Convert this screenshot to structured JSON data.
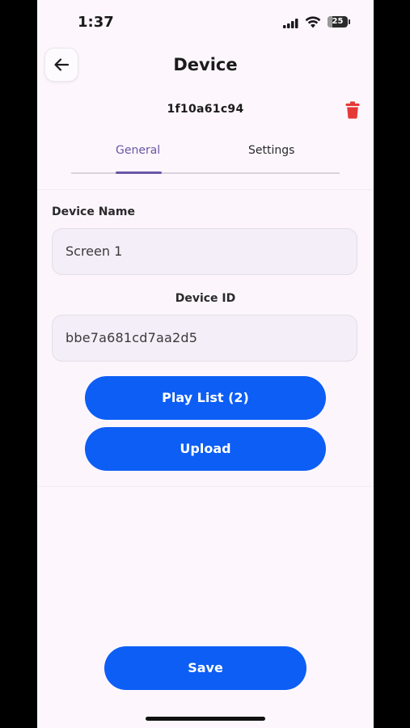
{
  "status_bar": {
    "time": "1:37",
    "battery_level": "25",
    "battery_fraction": 0.25
  },
  "header": {
    "title": "Device",
    "back_icon": "arrow-left-icon",
    "device_code": "1f10a61c94",
    "delete_icon": "trash-icon"
  },
  "tabs": [
    {
      "label": "General",
      "active": true
    },
    {
      "label": "Settings",
      "active": false
    }
  ],
  "form": {
    "device_name_label": "Device Name",
    "device_name_value": "Screen 1",
    "device_id_label": "Device ID",
    "device_id_value": "bbe7a681cd7aa2d5"
  },
  "actions": {
    "playlist_label": "Play List (2)",
    "upload_label": "Upload",
    "save_label": "Save"
  },
  "colors": {
    "accent_blue": "#0d5ef5",
    "tab_active": "#6a56a6",
    "delete_red": "#e53935",
    "background": "#fdf7fd"
  }
}
